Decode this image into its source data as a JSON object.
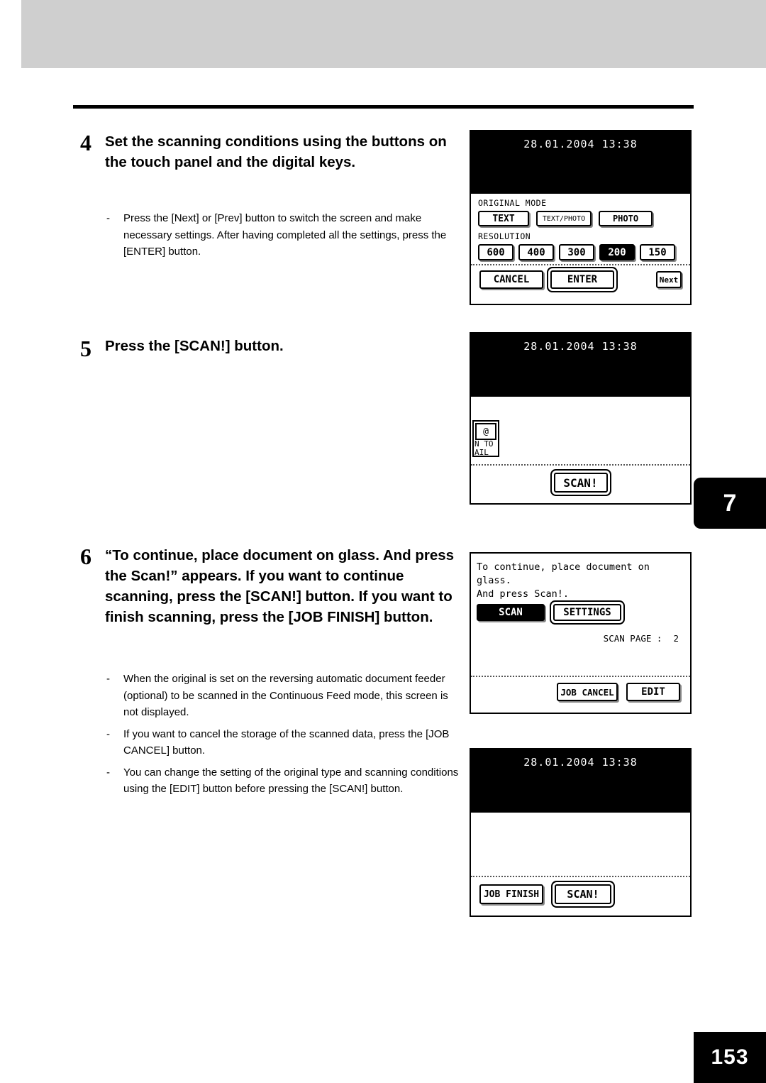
{
  "page": {
    "number": "153",
    "tab_number": "7"
  },
  "steps": [
    {
      "number": "4",
      "heading": "Set the scanning conditions using the buttons on the touch panel and the digital keys.",
      "bullets": [
        "Press the [Next] or [Prev] button to switch the screen and make necessary settings. After having completed all the settings, press the [ENTER] button."
      ]
    },
    {
      "number": "5",
      "heading": "Press the [SCAN!] button.",
      "bullets": []
    },
    {
      "number": "6",
      "heading": "“To continue, place document on glass. And press the Scan!” appears. If you want to continue scanning, press the [SCAN!] button. If you want to finish scanning, press the [JOB FINISH] button.",
      "bullets": [
        "When the original is set on the reversing automatic document feeder (optional) to be scanned in the Continuous Feed mode, this screen is not displayed.",
        "If you want to cancel the storage of the scanned data, press the [JOB CANCEL] button.",
        "You can change the setting of the original type and scanning conditions using the [EDIT] button before pressing the [SCAN!] button."
      ]
    }
  ],
  "screens": {
    "scan_conditions": {
      "datetime": "28.01.2004 13:38",
      "original_mode_label": "ORIGINAL MODE",
      "original_mode_keys": [
        {
          "label": "TEXT",
          "selected": false
        },
        {
          "label": "TEXT/PHOTO",
          "selected": false
        },
        {
          "label": "PHOTO",
          "selected": false
        }
      ],
      "resolution_label": "RESOLUTION",
      "resolution_keys": [
        {
          "label": "600",
          "selected": false
        },
        {
          "label": "400",
          "selected": false
        },
        {
          "label": "300",
          "selected": false
        },
        {
          "label": "200",
          "selected": true
        },
        {
          "label": "150",
          "selected": false
        }
      ],
      "footer_keys": [
        {
          "label": "CANCEL"
        },
        {
          "label": "ENTER"
        },
        {
          "label": "Next"
        }
      ]
    },
    "scan_ready": {
      "datetime": "28.01.2004 13:38",
      "mail_icon_label": "@",
      "mail_text_line1": "N TO",
      "mail_text_line2": "AIL",
      "scan_key": "SCAN!"
    },
    "continue_prompt": {
      "message_line1": "To continue, place document on glass.",
      "message_line2": "And press Scan!.",
      "keys": [
        {
          "label": "SCAN",
          "selected": true
        },
        {
          "label": "SETTINGS",
          "selected": false
        }
      ],
      "scan_page_label": "SCAN PAGE :",
      "scan_page_value": "2",
      "footer_keys": [
        {
          "label": "JOB CANCEL"
        },
        {
          "label": "EDIT"
        }
      ]
    },
    "job_finish": {
      "datetime": "28.01.2004 13:38",
      "footer_keys": [
        {
          "label": "JOB FINISH"
        },
        {
          "label": "SCAN!"
        }
      ]
    }
  }
}
